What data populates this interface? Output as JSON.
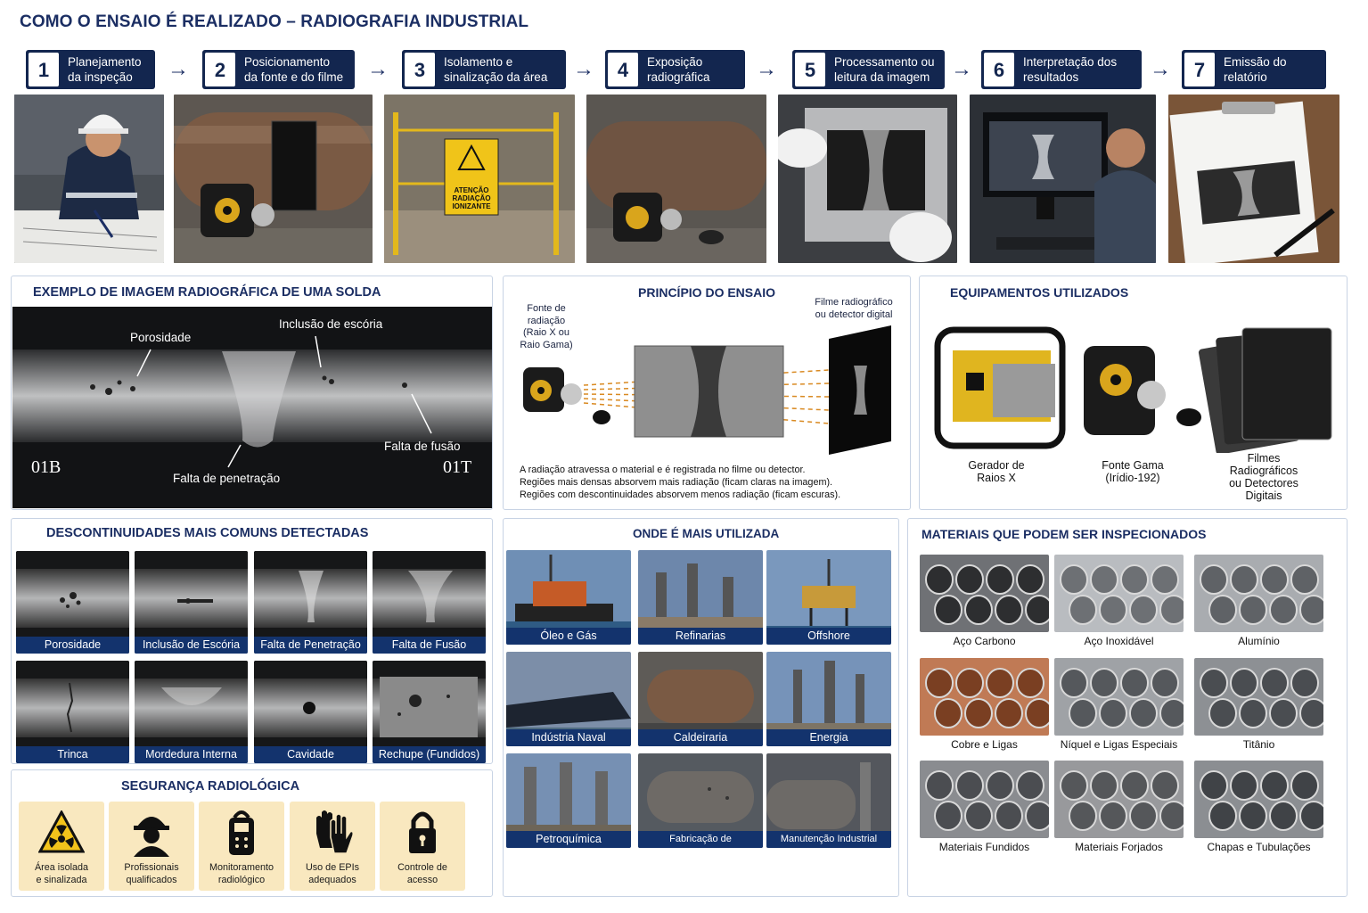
{
  "title": "COMO O ENSAIO É REALIZADO – RADIOGRAFIA INDUSTRIAL",
  "steps": [
    {
      "num": "1",
      "line1": "Planejamento",
      "line2": "da inspeção"
    },
    {
      "num": "2",
      "line1": "Posicionamento",
      "line2": "da fonte e do filme"
    },
    {
      "num": "3",
      "line1": "Isolamento e",
      "line2": "sinalização da área"
    },
    {
      "num": "4",
      "line1": "Exposição",
      "line2": "radiográfica"
    },
    {
      "num": "5",
      "line1": "Processamento ou",
      "line2": "leitura da imagem"
    },
    {
      "num": "6",
      "line1": "Interpretação dos",
      "line2": "resultados"
    },
    {
      "num": "7",
      "line1": "Emissão do",
      "line2": "relatório"
    }
  ],
  "warning_sign": {
    "line1": "ATENÇÃO",
    "line2": "RADIAÇÃO",
    "line3": "IONIZANTE"
  },
  "weld_example": {
    "title": "EXEMPLO DE IMAGEM RADIOGRÁFICA DE UMA SOLDA",
    "labels": {
      "porosidade": "Porosidade",
      "escoria": "Inclusão de escória",
      "fusao": "Falta de fusão",
      "penetracao": "Falta de penetração",
      "left_code": "01B",
      "right_code": "01T"
    }
  },
  "principle": {
    "title": "PRINCÍPIO DO ENSAIO",
    "source_label": [
      "Fonte de",
      "radiação",
      "(Raio X ou",
      "Raio Gama)"
    ],
    "film_label": [
      "Filme radiográfico",
      "ou detector digital"
    ],
    "text": [
      "A radiação atravessa o material e é registrada no filme ou detector.",
      "Regiões mais densas absorvem mais radiação (ficam claras na imagem).",
      "Regiões com descontinuidades absorvem menos radiação (ficam escuras)."
    ]
  },
  "equipment": {
    "title": "EQUIPAMENTOS UTILIZADOS",
    "items": [
      [
        "Gerador de",
        "Raios X"
      ],
      [
        "Fonte Gama",
        "(Irídio-192)"
      ],
      [
        "Filmes",
        "Radiográficos",
        "ou Detectores",
        "Digitais"
      ]
    ]
  },
  "discontinuities": {
    "title": "DESCONTINUIDADES MAIS COMUNS DETECTADAS",
    "items": [
      "Porosidade",
      "Inclusão de Escória",
      "Falta de Penetração",
      "Falta de Fusão",
      "Trinca",
      "Mordedura Interna",
      "Cavidade",
      "Rechupe (Fundidos)"
    ]
  },
  "safety": {
    "title": "SEGURANÇA RADIOLÓGICA",
    "items": [
      [
        "Área isolada",
        "e sinalizada"
      ],
      [
        "Profissionais",
        "qualificados"
      ],
      [
        "Monitoramento",
        "radiológico"
      ],
      [
        "Uso de EPIs",
        "adequados"
      ],
      [
        "Controle de",
        "acesso"
      ]
    ],
    "icons": [
      "radiation-warning-icon",
      "worker-helmet-icon",
      "dosimeter-icon",
      "gloves-icon",
      "padlock-icon"
    ]
  },
  "usage": {
    "title": "ONDE É MAIS UTILIZADA",
    "items": [
      "Óleo e Gás",
      "Refinarias",
      "Offshore",
      "Indústria Naval",
      "Caldeiraria",
      "Energia",
      "Petroquímica",
      "Fabricação de Equipamentos",
      "Manutenção Industrial"
    ]
  },
  "materials": {
    "title": "MATERIAIS QUE PODEM SER INSPECIONADOS",
    "items": [
      "Aço Carbono",
      "Aço Inoxidável",
      "Alumínio",
      "Cobre e Ligas",
      "Níquel e Ligas Especiais",
      "Titânio",
      "Materiais Fundidos",
      "Materiais Forjados",
      "Chapas e Tubulações"
    ]
  },
  "colors": {
    "navy": "#13264f",
    "accent_blue": "#1b2e63",
    "safety_bg": "#f9e8bf",
    "label_bar": "#13336d"
  }
}
